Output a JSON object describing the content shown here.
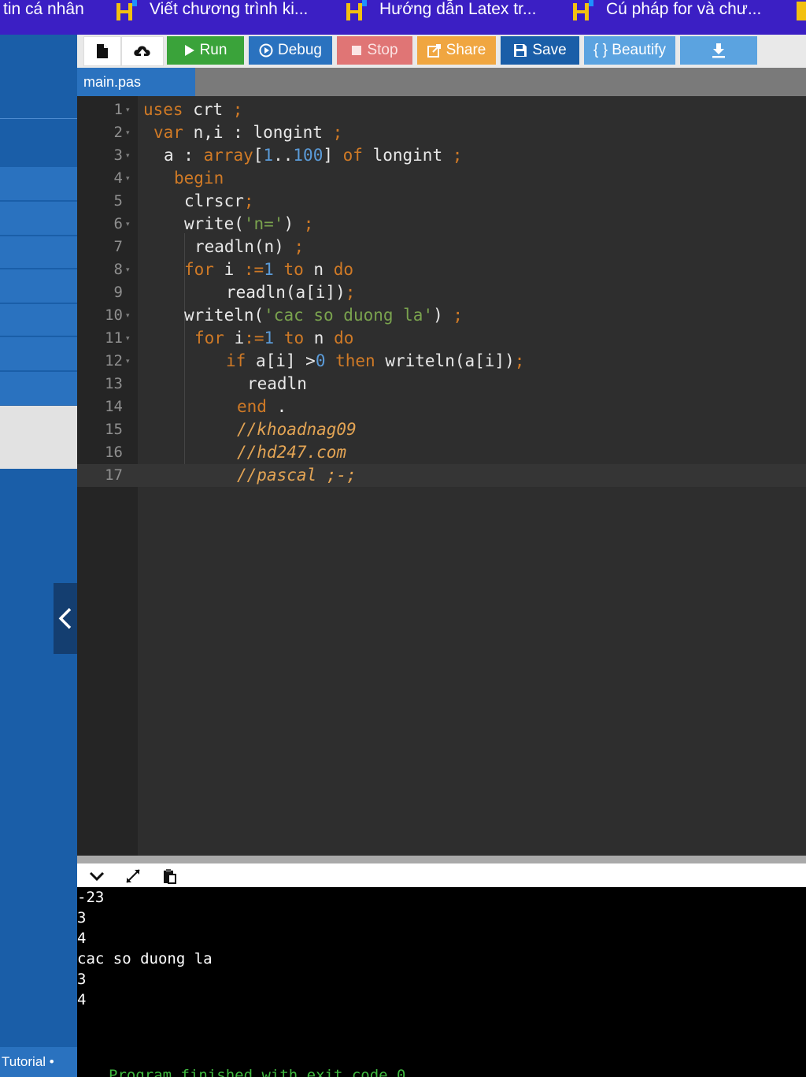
{
  "bookmarks": [
    {
      "label": "tin cá nhân",
      "icon": "none"
    },
    {
      "label": "Viết chương trình ki...",
      "icon": "hoc247-icon"
    },
    {
      "label": "Hướng dẫn Latex tr...",
      "icon": "hoc247-icon"
    },
    {
      "label": "Cú pháp for và chư...",
      "icon": "hoc247-icon"
    }
  ],
  "toolbar": {
    "run": "Run",
    "debug": "Debug",
    "stop": "Stop",
    "share": "Share",
    "save": "Save",
    "beautify": "{ } Beautify"
  },
  "tab": {
    "filename": "main.pas"
  },
  "editor": {
    "lines": [
      {
        "n": "1"
      },
      {
        "n": "2"
      },
      {
        "n": "3"
      },
      {
        "n": "4"
      },
      {
        "n": "5"
      },
      {
        "n": "6"
      },
      {
        "n": "7"
      },
      {
        "n": "8"
      },
      {
        "n": "9"
      },
      {
        "n": "10"
      },
      {
        "n": "11"
      },
      {
        "n": "12"
      },
      {
        "n": "13"
      },
      {
        "n": "14"
      },
      {
        "n": "15"
      },
      {
        "n": "16"
      },
      {
        "n": "17"
      }
    ],
    "tokens": {
      "l1": [
        "uses",
        " crt ",
        ";"
      ],
      "l2": [
        "var",
        " n,i : longint ",
        ";"
      ],
      "l3": [
        "a : ",
        "array",
        "[",
        "1",
        "..",
        "100",
        "] ",
        "of",
        " longint ",
        ";"
      ],
      "l4": [
        "begin"
      ],
      "l5": [
        "clrscr",
        ";"
      ],
      "l6": [
        "write(",
        "'n='",
        ") ",
        ";"
      ],
      "l7": [
        "readln(n) ",
        ";"
      ],
      "l8": [
        "for",
        " i ",
        ":=",
        "1",
        " ",
        "to",
        " n ",
        "do"
      ],
      "l9": [
        "readln(a[i])",
        ";"
      ],
      "l10": [
        "writeln(",
        "'cac so duong la'",
        ") ",
        ";"
      ],
      "l11": [
        "for",
        " i",
        ":=",
        "1",
        " ",
        "to",
        " n ",
        "do"
      ],
      "l12": [
        "if",
        " a[i] >",
        "0",
        " ",
        "then",
        " writeln(a[i])",
        ";"
      ],
      "l13": [
        "readln"
      ],
      "l14": [
        "end",
        " ."
      ],
      "l15": [
        "//khoadnag09"
      ],
      "l16": [
        "//hd247.com"
      ],
      "l17": [
        "//pascal ;-;"
      ]
    }
  },
  "sidebar": {
    "tutorial": "Tutorial •"
  },
  "output": {
    "lines": [
      "-23",
      "3",
      "4",
      "cac so duong la",
      "3",
      "4"
    ],
    "finished": "Program finished with exit code 0"
  },
  "colors": {
    "keyword": "#d07a26",
    "string": "#7aa34e",
    "number": "#5b9bd8",
    "comment": "#e3a454",
    "run": "#3aa33a",
    "debug": "#2a72bf",
    "stop": "#e07575",
    "share": "#f0a640",
    "save": "#1a5ea8",
    "beautify": "#5ba3e0"
  }
}
